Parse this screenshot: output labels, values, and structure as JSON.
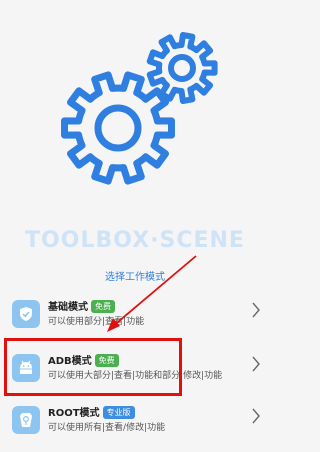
{
  "app": {
    "brand": "TOOLBOX·SCENE",
    "subtitle": "选择工作模式"
  },
  "options": [
    {
      "label": "基础模式",
      "badge": "免费",
      "badge_color": "#4caf50",
      "desc": "可以使用部分|查看|功能",
      "icon": "shield-icon"
    },
    {
      "label": "ADB模式",
      "badge": "免费",
      "badge_color": "#4caf50",
      "desc": "可以使用大部分|查看|功能和部分|修改|功能",
      "icon": "android-icon"
    },
    {
      "label": "ROOT模式",
      "badge": "专业版",
      "badge_color": "#3d8de0",
      "desc": "可以使用所有|查看/修改|功能",
      "icon": "root-icon"
    }
  ],
  "colors": {
    "accent": "#2f7fe0",
    "gear": "#2f7fe0",
    "annotation": "#e01010"
  }
}
